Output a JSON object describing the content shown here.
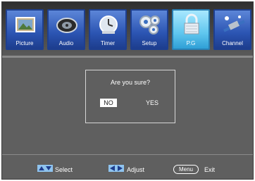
{
  "menu": {
    "tabs": [
      {
        "label": "Picture",
        "icon": "picture-icon"
      },
      {
        "label": "Audio",
        "icon": "audio-icon"
      },
      {
        "label": "Timer",
        "icon": "timer-icon"
      },
      {
        "label": "Setup",
        "icon": "setup-icon"
      },
      {
        "label": "P.G",
        "icon": "lock-icon",
        "active": true
      },
      {
        "label": "Channel",
        "icon": "channel-icon"
      }
    ]
  },
  "dialog": {
    "question": "Are you sure?",
    "no_label": "NO",
    "yes_label": "YES",
    "selected": "NO"
  },
  "footer": {
    "select_label": "Select",
    "adjust_label": "Adjust",
    "menu_key": "Menu",
    "exit_label": "Exit"
  },
  "colors": {
    "panel": "#5f5f5f",
    "tab": "#2b54b2",
    "tab_active": "#5fc6ee",
    "text": "#ffffff"
  }
}
